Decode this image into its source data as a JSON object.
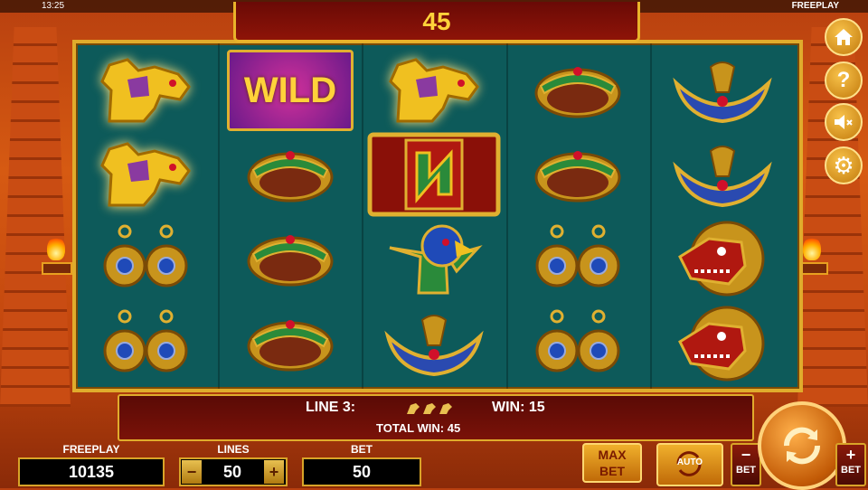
{
  "status_bar": {
    "time": "13:25",
    "mode": "FREEPLAY"
  },
  "win_counter": "45",
  "reels": [
    [
      "jaguar",
      "jaguar",
      "earrings",
      "earrings"
    ],
    [
      "wild",
      "ring",
      "ring",
      "ring"
    ],
    [
      "jaguar",
      "scatter",
      "eagle",
      "bird-necklace"
    ],
    [
      "ring",
      "ring",
      "earrings",
      "earrings"
    ],
    [
      "bird-necklace",
      "bird-necklace",
      "serpent-mask",
      "serpent-mask"
    ]
  ],
  "wild_label": "WILD",
  "info": {
    "line_label": "LINE 3:",
    "win_label": "WIN: 15",
    "total_label": "TOTAL WIN: 45"
  },
  "controls": {
    "freeplay_label": "FREEPLAY",
    "freeplay_value": "10135",
    "lines_label": "LINES",
    "lines_value": "50",
    "bet_label": "BET",
    "bet_value": "50",
    "max_bet_line1": "MAX",
    "max_bet_line2": "BET",
    "auto_label": "AUTO",
    "bet_minus_label": "BET",
    "bet_plus_label": "BET",
    "minus": "−",
    "plus": "+"
  },
  "side_menu": [
    "home-icon",
    "help-icon",
    "sound-off-icon",
    "settings-icon"
  ],
  "colors": {
    "gold": "#e0ac2c",
    "reel_bg": "#0d5a5a",
    "panel_red": "#6a0a06",
    "counter_text": "#ffd23a"
  }
}
